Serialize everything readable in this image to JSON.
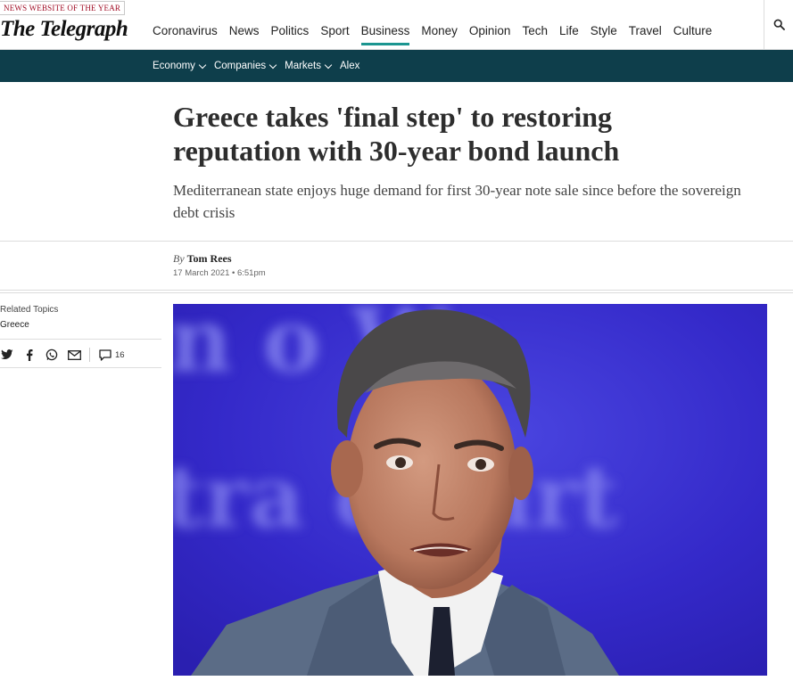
{
  "header": {
    "badge": "NEWS WEBSITE OF THE YEAR",
    "logo": "The Telegraph",
    "nav": [
      {
        "label": "Coronavirus",
        "active": false
      },
      {
        "label": "News",
        "active": false
      },
      {
        "label": "Politics",
        "active": false
      },
      {
        "label": "Sport",
        "active": false
      },
      {
        "label": "Business",
        "active": true
      },
      {
        "label": "Money",
        "active": false
      },
      {
        "label": "Opinion",
        "active": false
      },
      {
        "label": "Tech",
        "active": false
      },
      {
        "label": "Life",
        "active": false
      },
      {
        "label": "Style",
        "active": false
      },
      {
        "label": "Travel",
        "active": false
      },
      {
        "label": "Culture",
        "active": false
      }
    ],
    "search_icon": "search-icon"
  },
  "subnav": {
    "items": [
      {
        "label": "Economy",
        "dropdown": true
      },
      {
        "label": "Companies",
        "dropdown": true
      },
      {
        "label": "Markets",
        "dropdown": true
      },
      {
        "label": "Alex",
        "dropdown": false
      }
    ]
  },
  "article": {
    "headline": "Greece takes 'final step' to restoring reputation with 30-year bond launch",
    "standfirst": "Mediterranean state enjoys huge demand for first 30-year note sale since before the sovereign debt crisis",
    "byline_prefix": "By",
    "author": "Tom Rees",
    "date": "17 March 2021 • 6:51pm",
    "backdrop_text_line1": "n o Wo",
    "backdrop_text_line2": "tra    c Part"
  },
  "sidebar": {
    "related_label": "Related Topics",
    "related_topic": "Greece",
    "share_icons": [
      "twitter-icon",
      "facebook-icon",
      "whatsapp-icon",
      "email-icon"
    ],
    "comment_icon": "comment-icon",
    "comment_count": "16"
  },
  "colors": {
    "accent": "#1b9590",
    "subnav_bg": "#0e3e4b",
    "badge": "#a10d25",
    "photo_bg": "#3128c8"
  }
}
